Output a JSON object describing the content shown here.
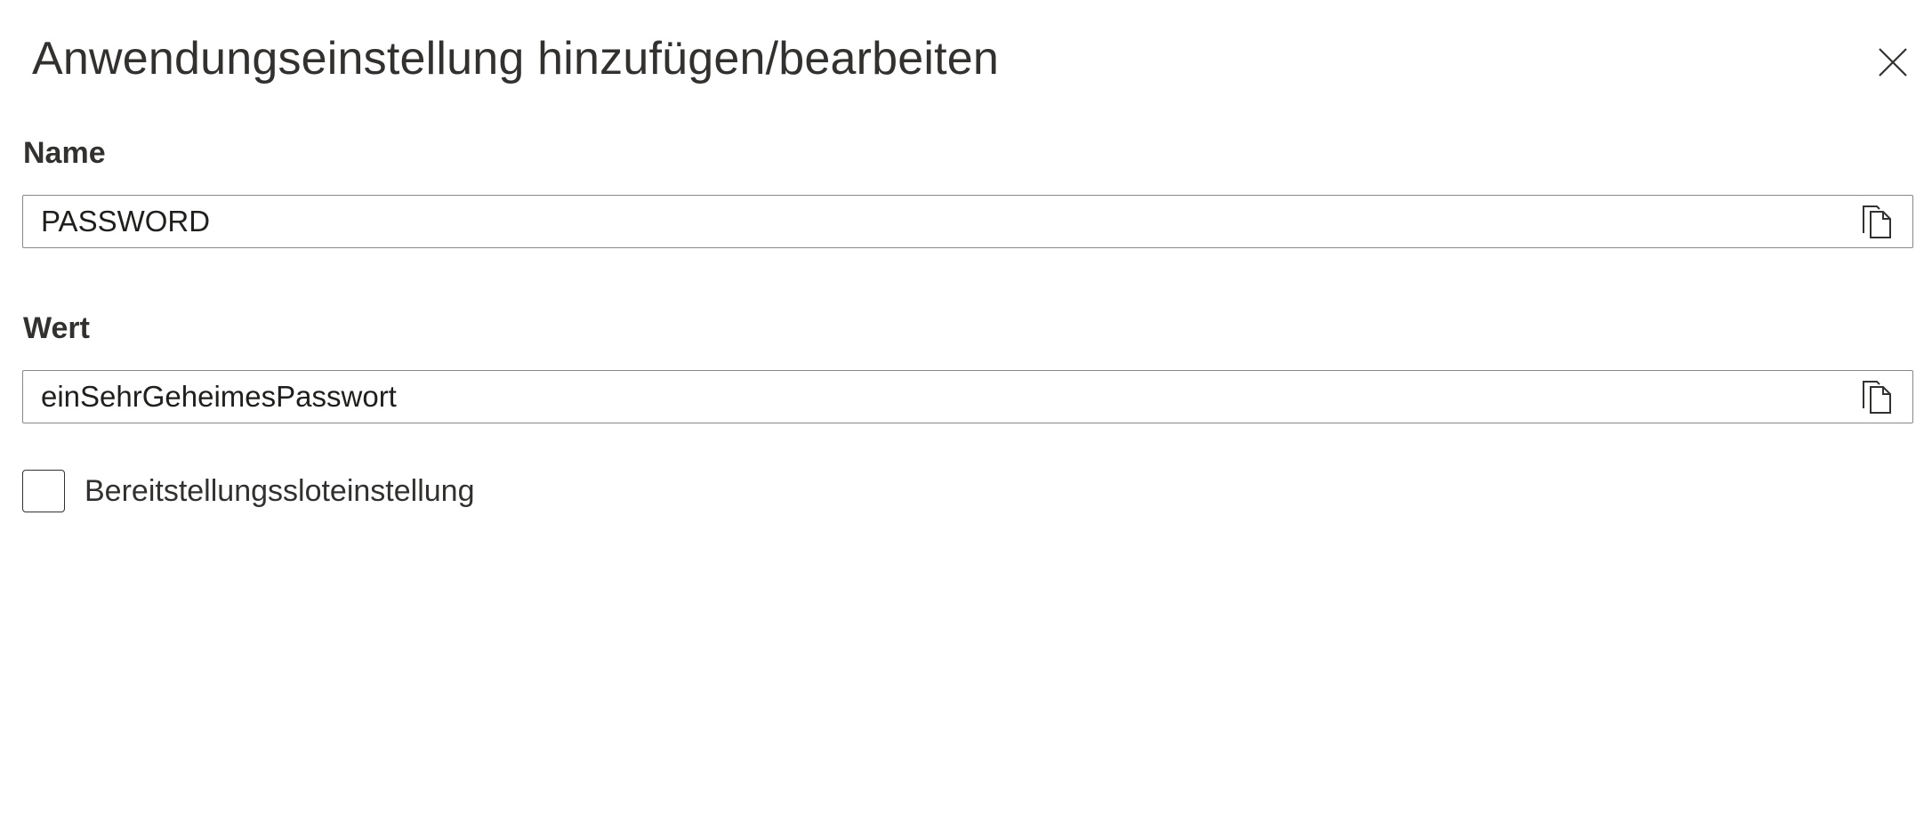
{
  "panel": {
    "title": "Anwendungseinstellung hinzufügen/bearbeiten",
    "close_icon": "close-icon"
  },
  "name_field": {
    "label": "Name",
    "value": "PASSWORD",
    "copy_icon": "copy-icon"
  },
  "value_field": {
    "label": "Wert",
    "value": "einSehrGeheimesPasswort",
    "copy_icon": "copy-icon"
  },
  "slot_setting": {
    "label": "Bereitstellungssloteinstellung",
    "checked": false
  }
}
